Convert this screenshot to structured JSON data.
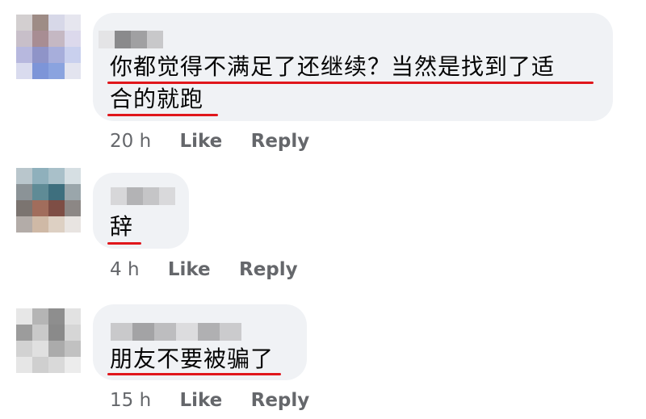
{
  "comments": [
    {
      "text_line1": "你都觉得不满足了还继续？当然是找到了适",
      "text_line2": "合的就跑",
      "time": "20 h",
      "like_label": "Like",
      "reply_label": "Reply"
    },
    {
      "text_line1": "辞",
      "time": "4 h",
      "like_label": "Like",
      "reply_label": "Reply"
    },
    {
      "text_line1": "朋友不要被骗了",
      "time": "15 h",
      "like_label": "Like",
      "reply_label": "Reply"
    }
  ],
  "colors": {
    "bubble": "#f0f2f5",
    "underline": "#e0161b",
    "meta_text": "#65676b"
  }
}
